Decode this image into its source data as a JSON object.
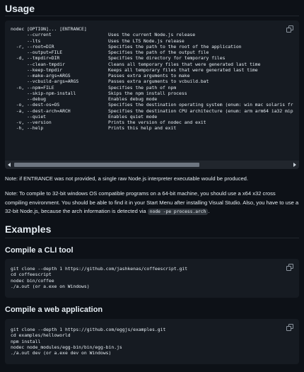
{
  "usage": {
    "heading": "Usage",
    "rows": [
      {
        "opt": "nodec [OPTION]... [ENTRANCE]",
        "desc": ""
      },
      {
        "opt": "      --current",
        "desc": "Uses the current Node.js release"
      },
      {
        "opt": "      --lts",
        "desc": "Uses the LTS Node.js release"
      },
      {
        "opt": "  -r, --root=DIR",
        "desc": "Specifies the path to the root of the application"
      },
      {
        "opt": "      --output=FILE",
        "desc": "Specifies the path of the output file"
      },
      {
        "opt": "  -d, --tmpdir=DIR",
        "desc": "Specifies the directory for temporary files"
      },
      {
        "opt": "      --clean-tmpdir",
        "desc": "Cleans all temporary files that were generated last time"
      },
      {
        "opt": "      --keep-tmpdir",
        "desc": "Keeps all temporary files that were generated last time"
      },
      {
        "opt": "      --make-args=ARGS",
        "desc": "Passes extra arguments to make"
      },
      {
        "opt": "      --vcbuild-args=ARGS",
        "desc": "Passes extra arguments to vcbuild.bat"
      },
      {
        "opt": "  -n, --npm=FILE",
        "desc": "Specifies the path of npm"
      },
      {
        "opt": "      --skip-npm-install",
        "desc": "Skips the npm install process"
      },
      {
        "opt": "      --debug",
        "desc": "Enables debug mode"
      },
      {
        "opt": "  -o, --dest-os=OS",
        "desc": "Specifies the destination operating system (enum: win mac solaris fr"
      },
      {
        "opt": "  -a, --dest-arch=ARCH",
        "desc": "Specifies the destination CPU architecture (enum: arm arm64 ia32 mip"
      },
      {
        "opt": "      --quiet",
        "desc": "Enables quiet mode"
      },
      {
        "opt": "  -v, --version",
        "desc": "Prints the version of nodec and exit"
      },
      {
        "opt": "  -h, --help",
        "desc": "Prints this help and exit"
      }
    ]
  },
  "notes": {
    "note1": "Note: if ENTRANCE was not provided, a single raw Node.js interpreter executable would be produced.",
    "note2_text": "Note: To compile to 32-bit windows OS compatible programs on a 64-bit machine, you should use a x64 x32 cross compiling environment. You should be able to find it in your Start Menu after installing Visual Studio. Also, you have to use a 32-bit Node.js, because the arch information is detected via ",
    "note2_code": "node -pe process.arch",
    "note2_end": "."
  },
  "examples": {
    "heading": "Examples",
    "cli": {
      "title": "Compile a CLI tool",
      "code": "git clone --depth 1 https://github.com/jashkenas/coffeescript.git\ncd coffeescript\nnodec bin/coffee\n./a.out (or a.exe on Windows)"
    },
    "web": {
      "title": "Compile a web application",
      "code": "git clone --depth 1 https://github.com/eggjs/examples.git\ncd examples/helloworld\nnpm install\nnodec node_modules/egg-bin/bin/egg-bin.js\n./a.out dev (or a.exe dev on Windows)"
    }
  },
  "icons": {
    "copy": "copy-icon",
    "scroll_left": "arrow-left-icon",
    "scroll_right": "arrow-right-icon"
  }
}
